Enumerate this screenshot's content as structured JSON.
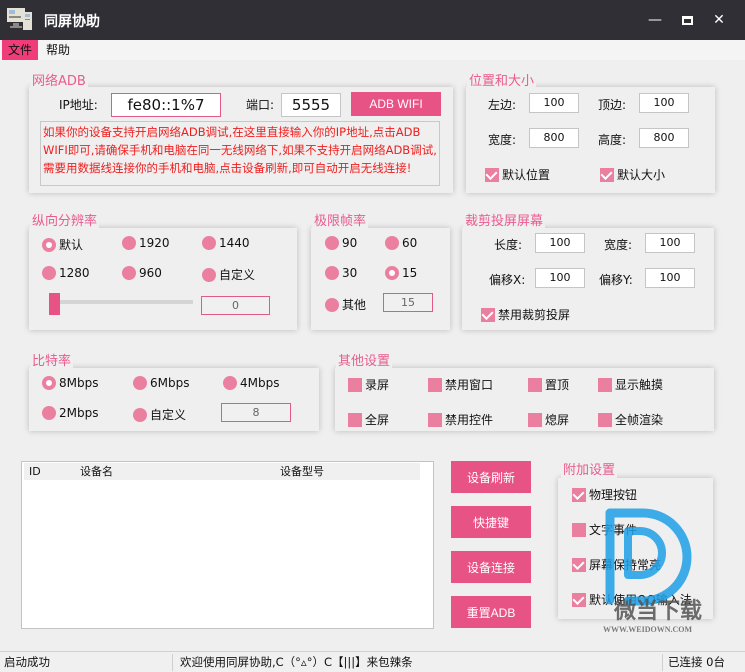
{
  "window": {
    "title": "同屏协助",
    "minimize_icon": "minimize-icon",
    "maximize_icon": "maximize-icon",
    "close_icon": "close-icon"
  },
  "menu": {
    "items": [
      {
        "label": "文件",
        "active": true
      },
      {
        "label": "帮助",
        "active": false
      }
    ]
  },
  "network_adb": {
    "group_label": "网络ADB",
    "ip_label": "IP地址:",
    "ip_value": "fe80::1%7",
    "port_label": "端口:",
    "port_value": "5555",
    "button_label": "ADB WIFI",
    "note": "如果你的设备支持开启网络ADB调试,在这里直接输入你的IP地址,点击ADB WIFI即可,请确保手机和电脑在同一无线网络下,如果不支持开启网络ADB调试,需要用数据线连接你的手机和电脑,点击设备刷新,即可自动开启无线连接!"
  },
  "position_size": {
    "group_label": "位置和大小",
    "left_label": "左边:",
    "left_value": "100",
    "top_label": "顶边:",
    "top_value": "100",
    "width_label": "宽度:",
    "width_value": "800",
    "height_label": "高度:",
    "height_value": "800",
    "default_pos_label": "默认位置",
    "default_pos_checked": true,
    "default_size_label": "默认大小",
    "default_size_checked": true
  },
  "resolution": {
    "group_label": "纵向分辨率",
    "options": [
      {
        "label": "默认",
        "selected": true
      },
      {
        "label": "1920",
        "selected": false
      },
      {
        "label": "1440",
        "selected": false
      },
      {
        "label": "1280",
        "selected": false
      },
      {
        "label": "960",
        "selected": false
      },
      {
        "label": "自定义",
        "selected": false
      }
    ],
    "slider_value": 0,
    "custom_value": "0"
  },
  "framerate": {
    "group_label": "极限帧率",
    "options": [
      {
        "label": "90",
        "selected": false
      },
      {
        "label": "60",
        "selected": false
      },
      {
        "label": "30",
        "selected": false
      },
      {
        "label": "15",
        "selected": true
      },
      {
        "label": "其他",
        "selected": false
      }
    ],
    "custom_value": "15"
  },
  "crop": {
    "group_label": "裁剪投屏屏幕",
    "length_label": "长度:",
    "length_value": "100",
    "width_label": "宽度:",
    "width_value": "100",
    "offset_x_label": "偏移X:",
    "offset_x_value": "100",
    "offset_y_label": "偏移Y:",
    "offset_y_value": "100",
    "disable_label": "禁用裁剪投屏",
    "disable_checked": true
  },
  "bitrate": {
    "group_label": "比特率",
    "options": [
      {
        "label": "8Mbps",
        "selected": true
      },
      {
        "label": "6Mbps",
        "selected": false
      },
      {
        "label": "4Mbps",
        "selected": false
      },
      {
        "label": "2Mbps",
        "selected": false
      },
      {
        "label": "自定义",
        "selected": false
      }
    ],
    "custom_value": "8"
  },
  "other": {
    "group_label": "其他设置",
    "options": [
      {
        "label": "录屏",
        "checked": false
      },
      {
        "label": "禁用窗口",
        "checked": false
      },
      {
        "label": "置顶",
        "checked": false
      },
      {
        "label": "显示触摸",
        "checked": false
      },
      {
        "label": "全屏",
        "checked": false
      },
      {
        "label": "禁用控件",
        "checked": false
      },
      {
        "label": "熄屏",
        "checked": false
      },
      {
        "label": "全帧渲染",
        "checked": false
      }
    ]
  },
  "device_table": {
    "columns": [
      "ID",
      "设备名",
      "设备型号"
    ],
    "rows": []
  },
  "actions": {
    "refresh": "设备刷新",
    "shortcut": "快捷键",
    "connect": "设备连接",
    "reset": "重置ADB"
  },
  "extra": {
    "group_label": "附加设置",
    "options": [
      {
        "label": "物理按钮",
        "checked": true
      },
      {
        "label": "文字事件",
        "checked": false
      },
      {
        "label": "屏幕保持常亮",
        "checked": true
      },
      {
        "label": "默认使用QQ输入法",
        "checked": true
      }
    ]
  },
  "status": {
    "left": "启动成功",
    "middle": "欢迎使用同屏协助,C（°▵°）C【|||】来包辣条",
    "right": "已连接 0台"
  },
  "watermark": {
    "text": "微当下载",
    "url_text": "WWW.WEIDOWN.COM"
  }
}
